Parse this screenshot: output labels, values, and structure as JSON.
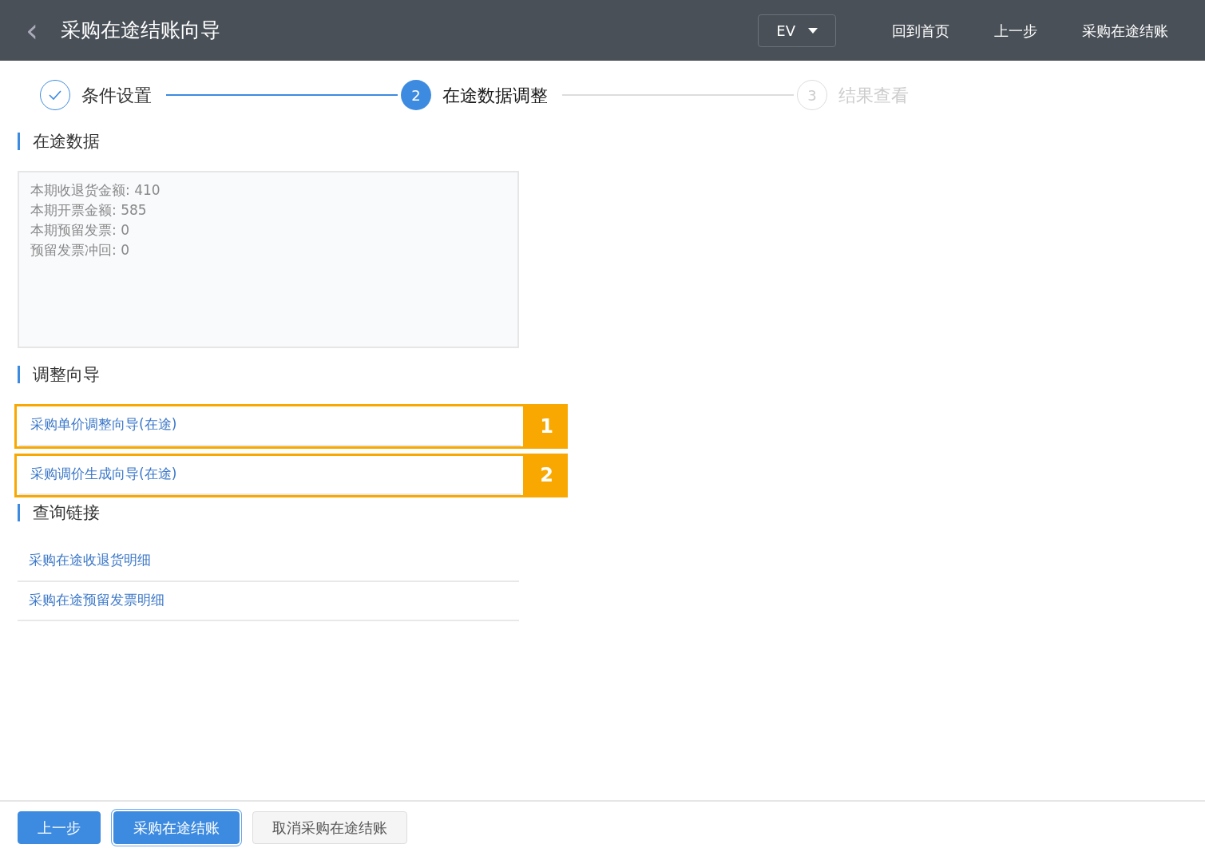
{
  "header": {
    "back": "‹",
    "title": "采购在途结账向导",
    "dropdown": "EV",
    "links": [
      "回到首页",
      "上一步",
      "采购在途结账"
    ]
  },
  "steps": [
    {
      "label": "条件设置",
      "done": true,
      "active": false
    },
    {
      "number": "2",
      "label": "在途数据调整",
      "done": false,
      "active": true
    },
    {
      "number": "3",
      "label": "结果查看",
      "done": false,
      "active": false
    }
  ],
  "sections": [
    {
      "title": "在途数据",
      "kind": "summary",
      "lines": [
        "本期收退货金额: 410",
        "本期开票金额: 585",
        "本期预留发票: 0",
        "预留发票冲回: 0"
      ]
    },
    {
      "title": "调整向导",
      "kind": "links",
      "links": [
        {
          "label": "采购单价调整向导(在途)",
          "callout": "1"
        },
        {
          "label": "采购调价生成向导(在途)",
          "callout": "2"
        }
      ]
    },
    {
      "title": "查询链接",
      "kind": "links",
      "links": [
        {
          "label": "采购在途收退货明细"
        },
        {
          "label": "采购在途预留发票明细"
        }
      ]
    }
  ],
  "footer_buttons": [
    {
      "label": "上一步",
      "kind": "primary"
    },
    {
      "label": "采购在途结账",
      "kind": "focused"
    },
    {
      "label": "取消采购在途结账",
      "kind": "default"
    }
  ]
}
